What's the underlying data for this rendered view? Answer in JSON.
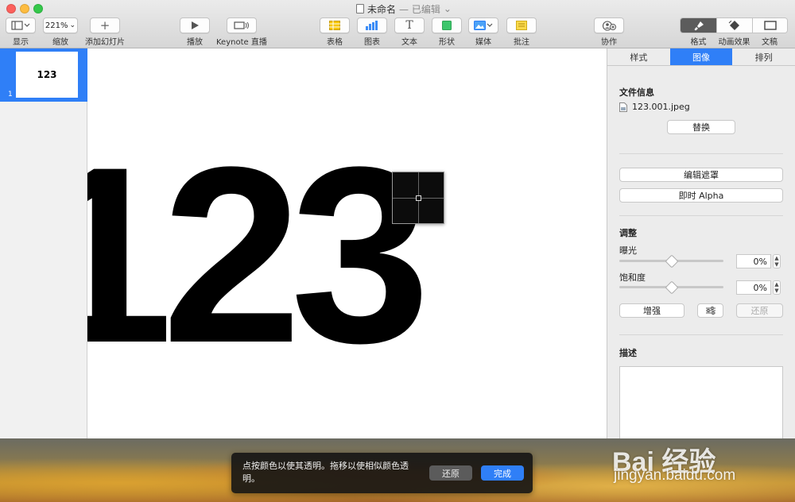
{
  "window": {
    "title": "未命名",
    "status": "— 已编辑"
  },
  "toolbar": {
    "view_label": "显示",
    "zoom_value": "221%",
    "zoom_label": "缩放",
    "add_slide_label": "添加幻灯片",
    "play_label": "播放",
    "keynote_live_label": "Keynote 直播",
    "table_label": "表格",
    "chart_label": "图表",
    "text_label": "文本",
    "shape_label": "形状",
    "media_label": "媒体",
    "comment_label": "批注",
    "collaborate_label": "协作",
    "format_label": "格式",
    "animate_label": "动画效果",
    "document_label": "文稿"
  },
  "navigator": {
    "slide_number": "1",
    "thumb_text": "123"
  },
  "canvas": {
    "image_text": "123"
  },
  "inspector": {
    "tabs": [
      "样式",
      "图像",
      "排列"
    ],
    "active_tab": "图像",
    "file_info_title": "文件信息",
    "file_name": "123.001.jpeg",
    "replace_label": "替换",
    "edit_mask_label": "编辑遮罩",
    "instant_alpha_label": "即时 Alpha",
    "adjust_title": "调整",
    "exposure_label": "曝光",
    "exposure_value": "0%",
    "exposure_level": 0.5,
    "saturation_label": "饱和度",
    "saturation_value": "0%",
    "saturation_level": 0.5,
    "enhance_label": "增强",
    "reset_label": "还原",
    "description_title": "描述"
  },
  "hud": {
    "instructions": "点按颜色以使其透明。拖移以使相似颜色透明。",
    "revert_label": "还原",
    "done_label": "完成"
  },
  "watermark": {
    "logo_text": "Bai 经验",
    "url": "jingyan.baidu.com"
  },
  "colors": {
    "accent": "#2f7ff7",
    "close": "#fc605c",
    "minimize": "#fdbc40",
    "maximize": "#34c84a"
  }
}
